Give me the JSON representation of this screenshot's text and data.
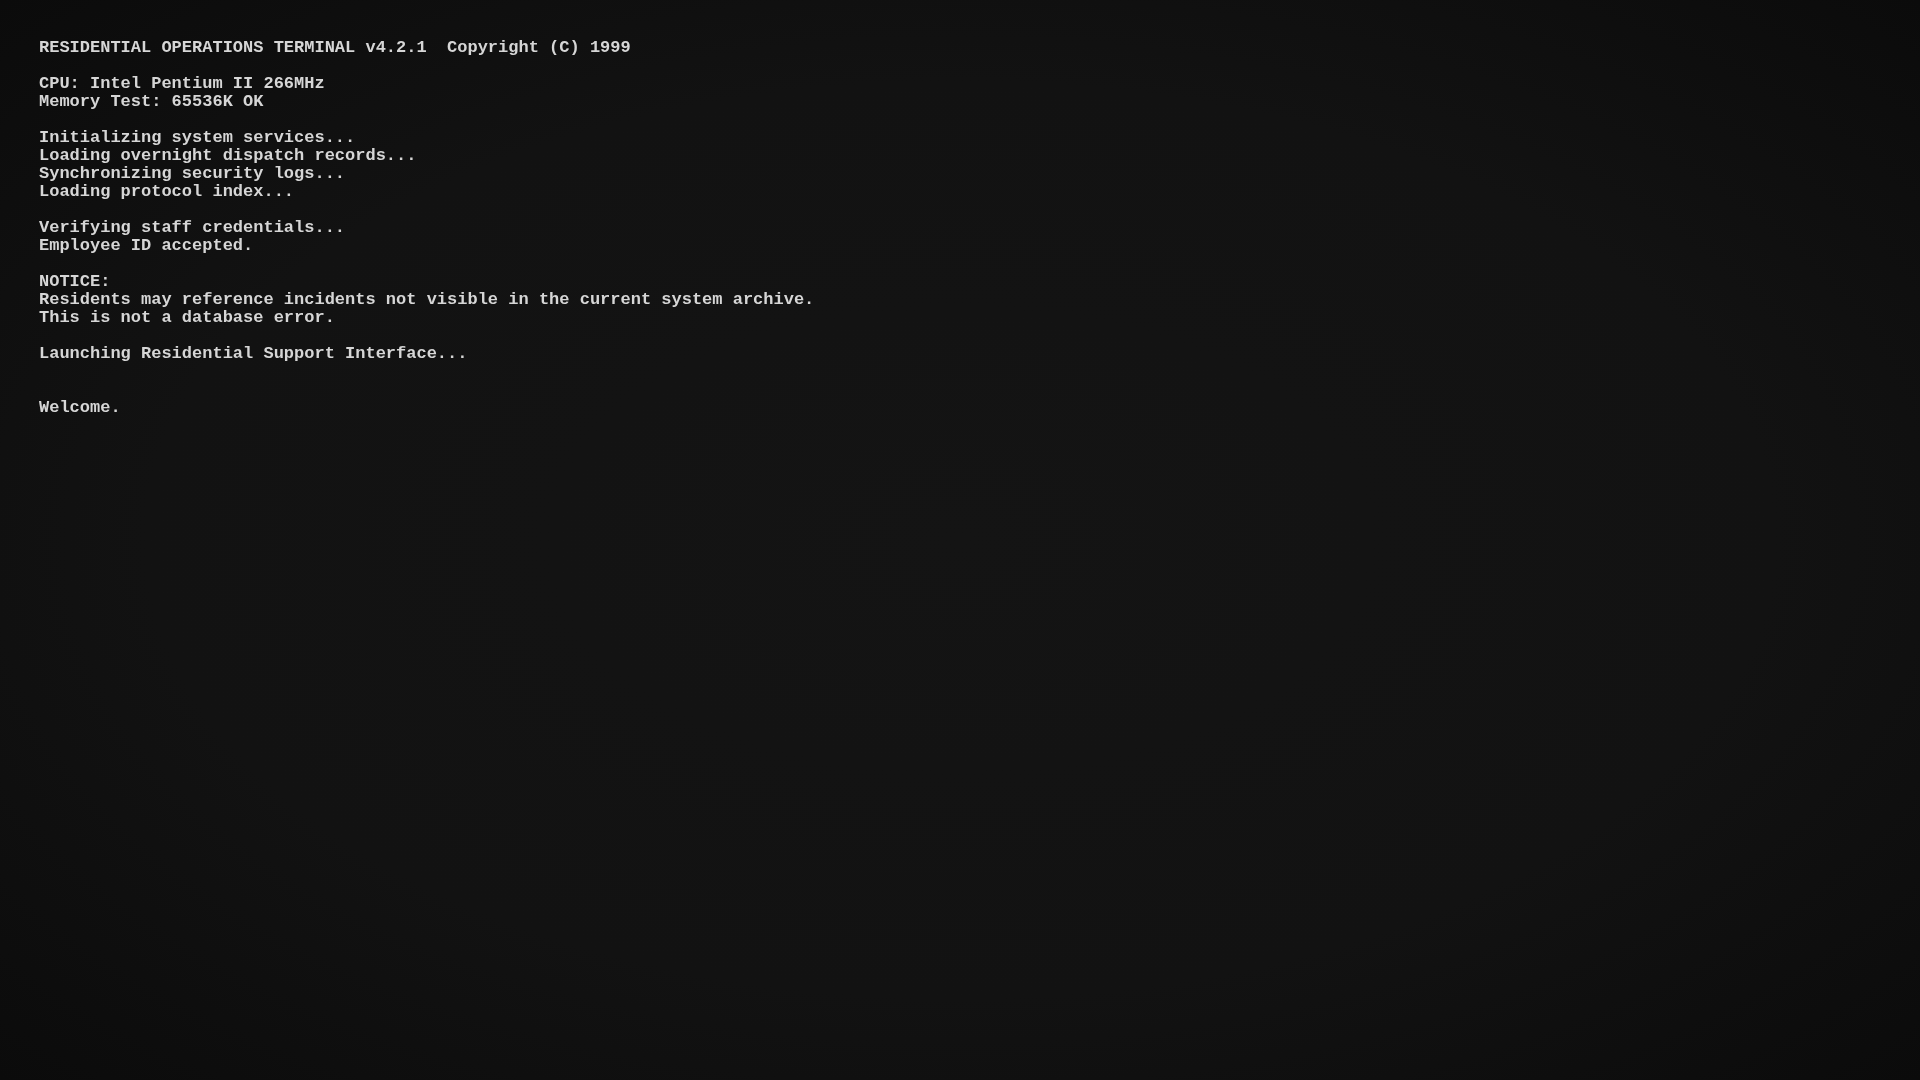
{
  "blocks": [
    {
      "kind": "section",
      "lines": [
        "RESIDENTIAL OPERATIONS TERMINAL v4.2.1  Copyright (C) 1999"
      ]
    },
    {
      "kind": "section",
      "lines": [
        "CPU: Intel Pentium II 266MHz",
        "Memory Test: 65536K OK"
      ]
    },
    {
      "kind": "section",
      "lines": [
        "Initializing system services...",
        "Loading overnight dispatch records...",
        "Synchronizing security logs...",
        "Loading protocol index..."
      ]
    },
    {
      "kind": "section",
      "lines": [
        "Verifying staff credentials...",
        "Employee ID accepted."
      ]
    },
    {
      "kind": "section",
      "lines": [
        "NOTICE:",
        "Residents may reference incidents not visible in the current system archive.",
        "This is not a database error."
      ]
    },
    {
      "kind": "section",
      "lines": [
        "Launching Residential Support Interface..."
      ]
    },
    {
      "kind": "greeting",
      "lines": [
        "Welcome."
      ]
    }
  ]
}
